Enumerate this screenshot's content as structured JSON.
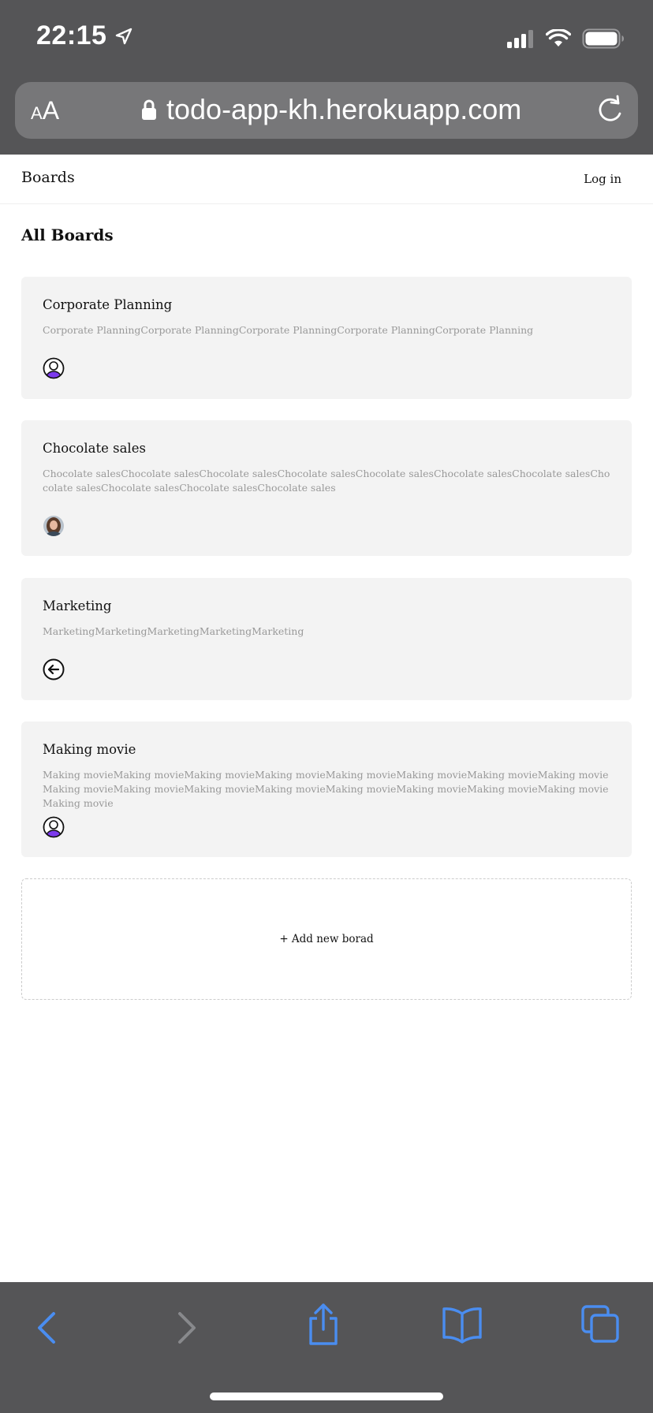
{
  "status_bar": {
    "time": "22:15"
  },
  "browser": {
    "text_size_small": "A",
    "text_size_big": "A",
    "url": "todo-app-kh.herokuapp.com"
  },
  "header": {
    "brand": "Boards",
    "login": "Log in"
  },
  "page": {
    "title": "All Boards",
    "add_board": "+ Add new borad"
  },
  "boards": [
    {
      "title": "Corporate Planning",
      "description": "Corporate PlanningCorporate PlanningCorporate PlanningCorporate PlanningCorporate Planning",
      "icon": "user-avatar-icon"
    },
    {
      "title": "Chocolate sales",
      "description": "Chocolate salesChocolate salesChocolate salesChocolate salesChocolate salesChocolate salesChocolate salesChocolate salesChocolate salesChocolate salesChocolate sales",
      "icon": "user-photo-avatar"
    },
    {
      "title": "Marketing",
      "description": "MarketingMarketingMarketingMarketingMarketing",
      "icon": "arrow-left-circle-icon"
    },
    {
      "title": "Making movie",
      "description": "Making movieMaking movieMaking movieMaking movieMaking movieMaking movieMaking movieMaking movieMaking movieMaking movieMaking movieMaking movieMaking movieMaking movieMaking movieMaking movieMaking movie",
      "icon": "user-avatar-icon"
    }
  ],
  "colors": {
    "accent": "#3b82f6",
    "avatar_purple": "#7c3aed",
    "chrome": "#555557"
  }
}
